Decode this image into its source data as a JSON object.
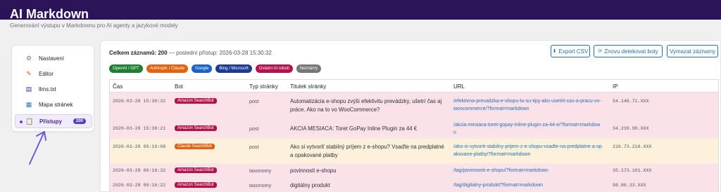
{
  "app": {
    "title": "AI Markdown",
    "subtitle": "Generování výstupu v Markdownu pro AI agenty a jazykové modely"
  },
  "sidebar": {
    "items": [
      {
        "label": "Nastavení",
        "icon": "gear-icon"
      },
      {
        "label": "Editor",
        "icon": "pencil-icon"
      },
      {
        "label": "llms.txt",
        "icon": "document-icon"
      },
      {
        "label": "Mapa stránek",
        "icon": "sitemap-icon"
      },
      {
        "label": "Přístupy",
        "icon": "clipboard-icon",
        "count": "200",
        "active": true
      }
    ]
  },
  "summary": {
    "total_label": "Celkem záznamů: 200",
    "last_access": "— poslední přístup: 2026-03-28 15:30:32"
  },
  "toolbar": {
    "export_label": "Export CSV",
    "redetect_label": "Znovu detekovat boty",
    "clear_label": "Vymazat záznamy"
  },
  "filters": [
    {
      "label": "OpenAI / GPT",
      "color": "#1e7e34"
    },
    {
      "label": "Anthropic / Claude",
      "color": "#e2620f"
    },
    {
      "label": "Google",
      "color": "#1a62c7"
    },
    {
      "label": "Bing / Microsoft",
      "color": "#1f3a93"
    },
    {
      "label": "Ostatní AI roboti",
      "color": "#b3124a"
    },
    {
      "label": "Neznámý",
      "color": "#777777"
    }
  ],
  "table": {
    "headers": [
      "Čas",
      "Bot",
      "Typ stránky",
      "Titulek stránky",
      "URL",
      "IP"
    ],
    "rows": [
      {
        "time": "2026-03-28 15:30:32",
        "bot": "Amazon SearchBot",
        "bot_color": "#b3124a",
        "type": "post",
        "title": "Automatizácia e-shopu zvýši efektivitu prevádzky, ušetrí čas aj práce. Ako na to vo WooCommerce?",
        "url": "/efektivna-prevadzka-e-shopu-tu-su-tipy-ako-usetrit-cas-a-pracu-vo-woocommerce/?format=markdown",
        "ip": "54.146.71.XXX",
        "bg": "#fbe1e8"
      },
      {
        "time": "2026-03-28 15:30:21",
        "bot": "Amazon SearchBot",
        "bot_color": "#b3124a",
        "type": "post",
        "title": "AKCIA MESIACA: Toret GoPay Inline Plugin za 44 €",
        "url": "/akcia-mesiaca-toret-gopay-inline-plugin-za-44-e/?format=markdown",
        "ip": "34.239.90.XXX",
        "bg": "#fbe1e8"
      },
      {
        "time": "2026-03-28 09:19:08",
        "bot": "Claude SearchBot",
        "bot_color": "#e2620f",
        "type": "post",
        "title": "Ako si vytvoriť stabilný príjem z e-shopu? Vsaďte na predplatné a opakované platby",
        "url": "/ako-si-vytvorit-stabilny-prijem-z-e-shopu-vsadte-na-predplatne-a-opakovane-platby/?format=markdown",
        "ip": "216.73.216.XXX",
        "bg": "#fdf1dc"
      },
      {
        "time": "2026-03-28 09:16:32",
        "bot": "Amazon SearchBot",
        "bot_color": "#b3124a",
        "type": "taxonomy",
        "title": "povinnosti e-shopu",
        "url": "/tag/povinnosti-e-shopu/?format=markdown",
        "ip": "35.173.101.XXX",
        "bg": "#fbe1e8"
      },
      {
        "time": "2026-03-28 09:16:22",
        "bot": "Amazon SearchBot",
        "bot_color": "#b3124a",
        "type": "taxonomy",
        "title": "digitálny produkt",
        "url": "/tag/digitalny-produkt/?format=markdown",
        "ip": "98.86.33.XXX",
        "bg": "#fbe1e8"
      }
    ]
  }
}
